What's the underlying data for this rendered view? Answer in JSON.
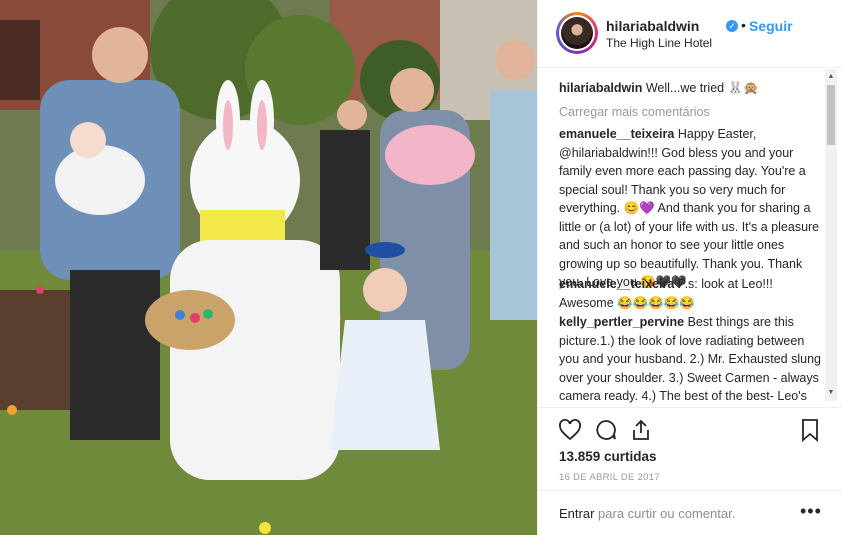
{
  "post": {
    "username": "hilariabaldwin",
    "follow_label": "Seguir",
    "separator": "•",
    "location": "The High Line Hotel",
    "caption_user": "hilariabaldwin",
    "caption_text": "Well...we tried 🐰🙊",
    "load_more": "Carregar mais comentários",
    "comments": [
      {
        "user": "emanuele__teixeira",
        "text": "Happy Easter, @hilariabaldwin!!! God bless you and your family even more each passing day. You're a special soul! Thank you so very much for everything. 😊💜 And thank you for sharing a little or (a lot) of your life with us. It's a pleasure and such an honor to see your little ones growing up so beautifully. Thank you. Thank you. Love you 😘🖤🖤"
      },
      {
        "user": "emanuele__teixeira",
        "text": "P.s: look at Leo!!! Awesome 😂😂😂😂😂"
      },
      {
        "user": "kelly_pertler_pervine",
        "text": "Best things are this picture.1.) the look of love radiating between you and your husband. 2.) Mr. Exhausted slung over your shoulder. 3.) Sweet Carmen - always camera ready. 4.) The best of the best- Leo's cute little toes"
      }
    ],
    "likes": "13.859 curtidas",
    "date": "16 DE ABRIL DE 2017",
    "comment_prompt_link": "Entrar",
    "comment_prompt_text": "para curtir ou comentar.",
    "more_options": "•••"
  },
  "icons": {
    "like": "heart-icon",
    "comment": "comment-bubble-icon",
    "share": "share-icon",
    "save": "bookmark-icon",
    "verified": "verified-badge-icon"
  },
  "colors": {
    "link_blue": "#3897f0",
    "muted": "#999999",
    "text": "#262626"
  }
}
